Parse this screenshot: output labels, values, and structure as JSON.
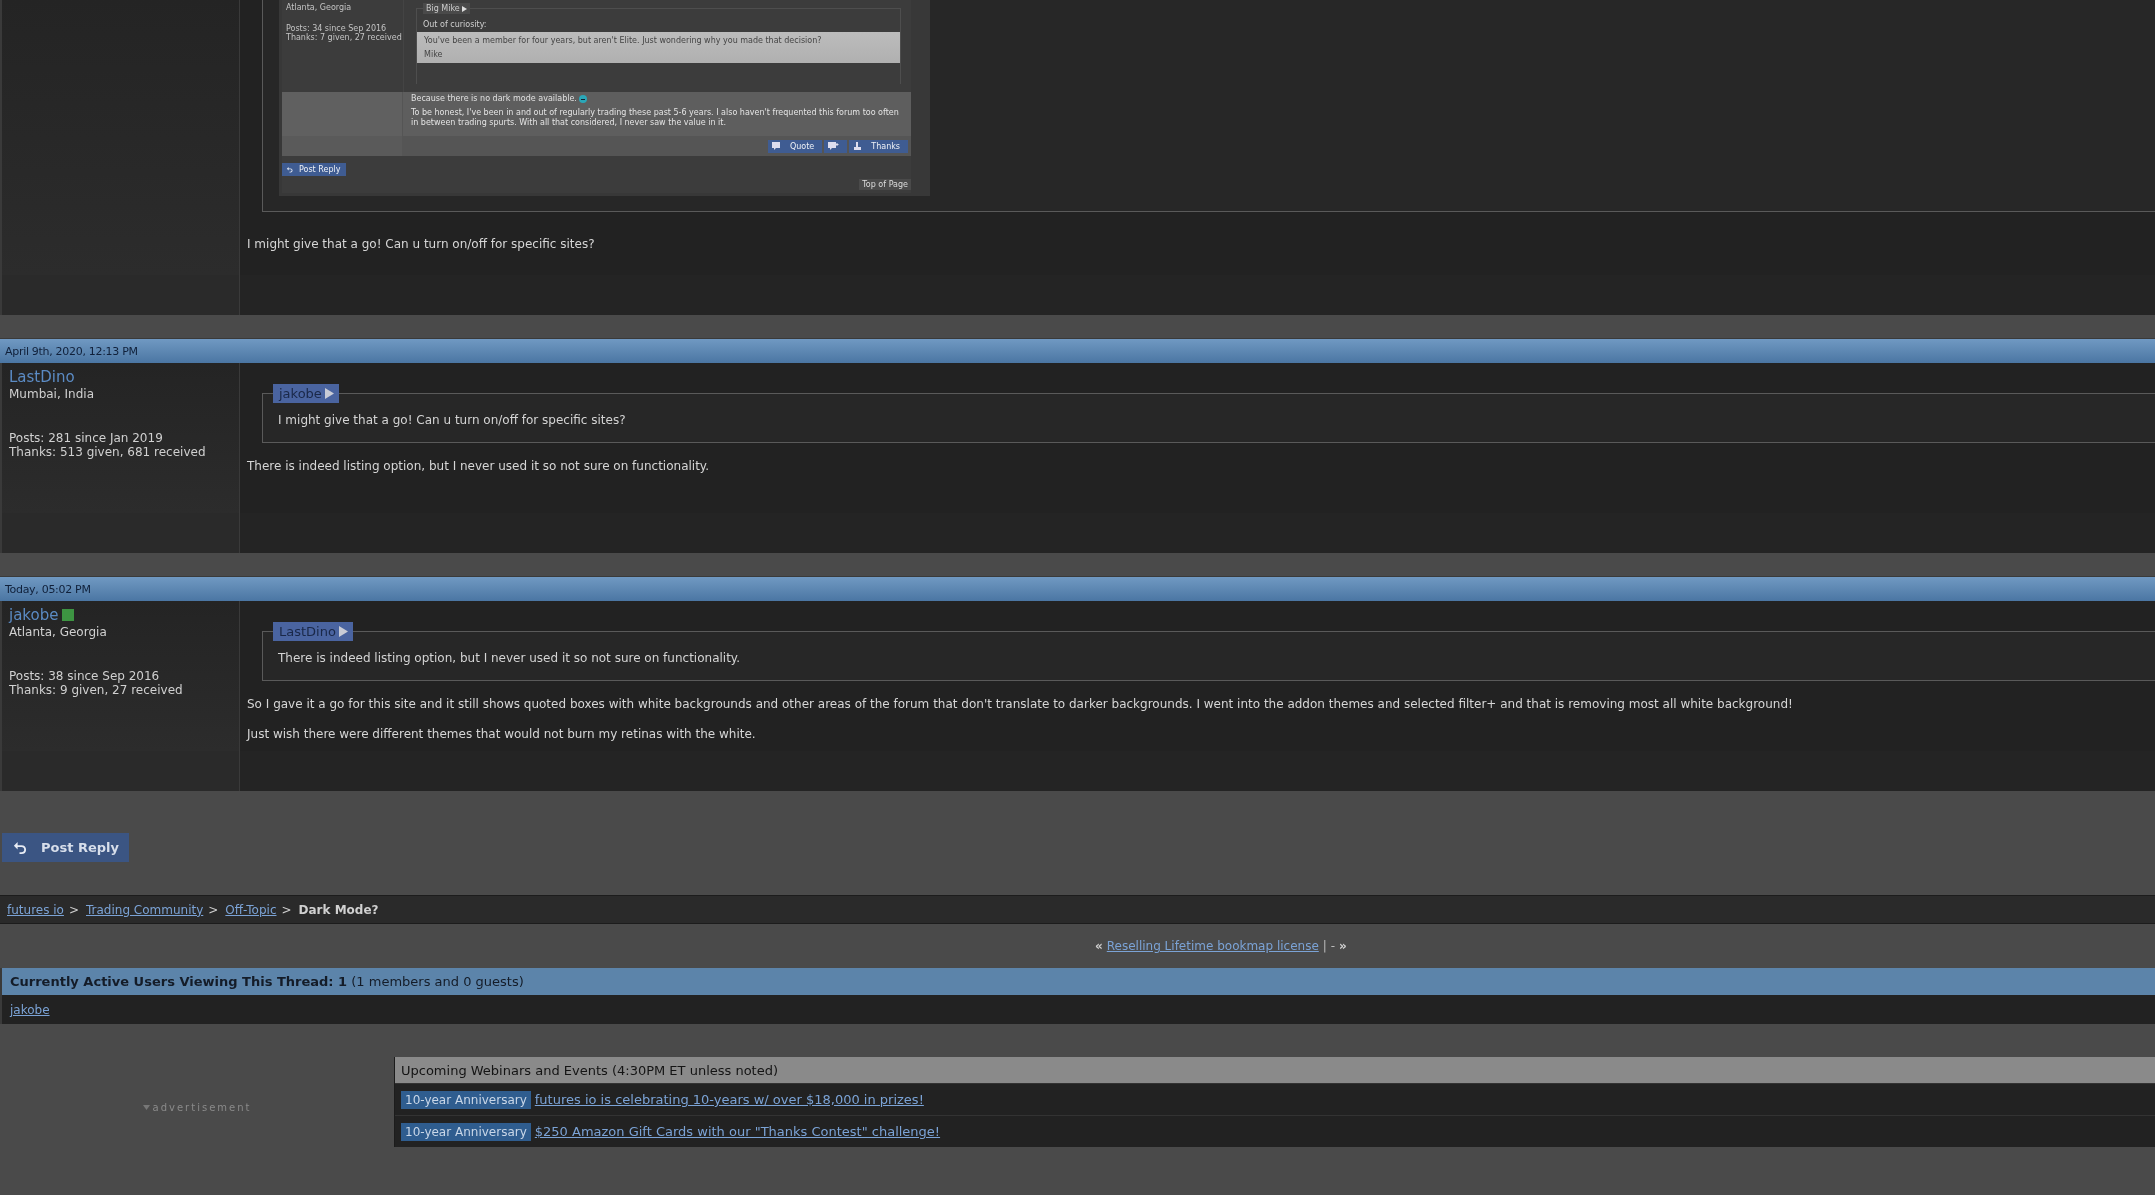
{
  "posts": [
    {
      "quote": {
        "kind": "screenshot",
        "screenshot": {
          "location": "Atlanta, Georgia",
          "posts": "Posts: 34 since Sep 2016",
          "thanks": "Thanks: 7 given, 27 received",
          "quote_author": "Big Mike",
          "quote_intro": "Out of curiosity:",
          "quote_lines": [
            "You've been a member for four years, but aren't Elite. Just wondering why you made that decision?",
            "Mike"
          ],
          "reply_lead": "Because there is no dark mode available.",
          "reply_text": "To be honest, I've been in and out of regularly trading these past 5-6 years. I also haven't frequented this forum too often in between trading spurts. With all that considered, I never saw the value in it.",
          "buttons": [
            {
              "kind": "quote",
              "label": "Quote"
            },
            {
              "kind": "multiquote"
            },
            {
              "kind": "thanks",
              "label": "Thanks"
            }
          ],
          "post_reply": "Post Reply",
          "top_of_page": "Top of Page"
        }
      },
      "paragraphs": [
        "I might give that a go! Can u turn on/off for specific sites?"
      ]
    },
    {
      "date": "April 9th, 2020, 12:13 PM",
      "author": {
        "name": "LastDino",
        "online": false,
        "location": "Mumbai, India",
        "posts": "Posts: 281 since Jan 2019",
        "thanks": "Thanks: 513 given, 681 received"
      },
      "quote": {
        "kind": "text",
        "author": "jakobe",
        "text": "I might give that a go! Can u turn on/off for specific sites?"
      },
      "paragraphs": [
        "There is indeed listing option, but I never used it so not sure on functionality."
      ]
    },
    {
      "date": "Today, 05:02 PM",
      "author": {
        "name": "jakobe",
        "online": true,
        "location": "Atlanta, Georgia",
        "posts": "Posts: 38 since Sep 2016",
        "thanks": "Thanks: 9 given, 27 received"
      },
      "quote": {
        "kind": "text",
        "author": "LastDino",
        "text": "There is indeed listing option, but I never used it so not sure on functionality."
      },
      "paragraphs": [
        "So I gave it a go for this site and it still shows quoted boxes with white backgrounds and other areas of the forum that don't translate to darker backgrounds. I went into the addon themes and selected filter+ and that is removing most all white background!",
        "Just wish there were different themes that would not burn my retinas with the white."
      ]
    }
  ],
  "post_reply_button": "Post Reply",
  "breadcrumb": [
    {
      "label": "futures io",
      "link": true,
      "after": ">"
    },
    {
      "label": "Trading Community",
      "link": true,
      "after": ">"
    },
    {
      "label": "Off-Topic",
      "link": true,
      "after": ">"
    },
    {
      "label": "Dark Mode?",
      "link": false
    }
  ],
  "thread_nav": {
    "prev": "«",
    "link": "Reselling Lifetime bookmap license",
    "middle": "| -",
    "next": "»"
  },
  "active_users": {
    "title": "**Currently Active Users Viewing This Thread: 1** (1 members and 0 guests)",
    "users": [
      "jakobe"
    ]
  },
  "advertisement": "advertisement",
  "events": {
    "title": "Upcoming Webinars and Events (4:30PM ET unless noted)",
    "items": [
      {
        "tag": "10-year Anniversary",
        "link": "futures io is celebrating 10-years w/ over $18,000 in prizes!"
      },
      {
        "tag": "10-year Anniversary",
        "link": "$250 Amazon Gift Cards with our \"Thanks Contest\" challenge!"
      }
    ]
  }
}
